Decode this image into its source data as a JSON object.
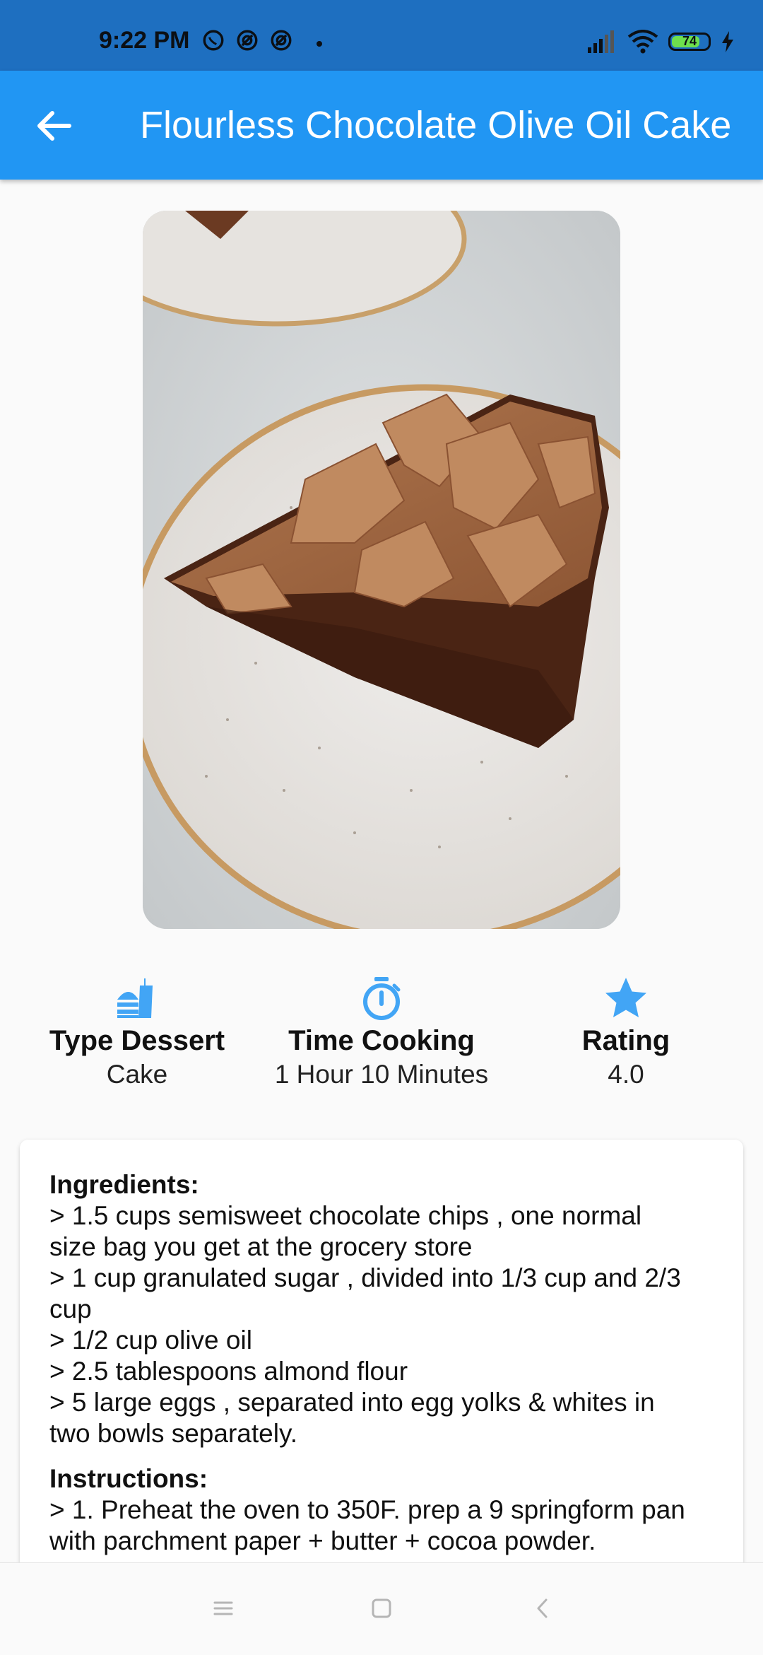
{
  "status": {
    "time": "9:22 PM",
    "battery": "74"
  },
  "appbar": {
    "title": "Flourless Chocolate Olive Oil Cake",
    "back_icon": "arrow-back-icon"
  },
  "info": [
    {
      "icon": "dessert-icon",
      "label": "Type Dessert",
      "value": "Cake"
    },
    {
      "icon": "timer-icon",
      "label": "Time Cooking",
      "value": "1 Hour 10 Minutes"
    },
    {
      "icon": "star-icon",
      "label": "Rating",
      "value": "4.0"
    }
  ],
  "ingredients": {
    "title": "Ingredients:",
    "lines": [
      "> 1.5 cups semisweet chocolate chips , one normal",
      "size bag you get at the grocery store",
      "> 1 cup granulated sugar , divided into 1/3 cup and 2/3",
      "cup",
      "> 1/2 cup olive oil",
      "> 2.5 tablespoons almond flour",
      "> 5 large eggs , separated into egg yolks & whites in",
      "two bowls separately."
    ]
  },
  "instructions": {
    "title": "Instructions:",
    "lines": [
      "> 1. Preheat the oven to 350F. prep a 9 springform pan",
      "with parchment paper + butter + cocoa powder."
    ]
  },
  "colors": {
    "primary": "#2196f3",
    "status_bar": "#1e6fc0",
    "accent_icon": "#42a5f5"
  }
}
